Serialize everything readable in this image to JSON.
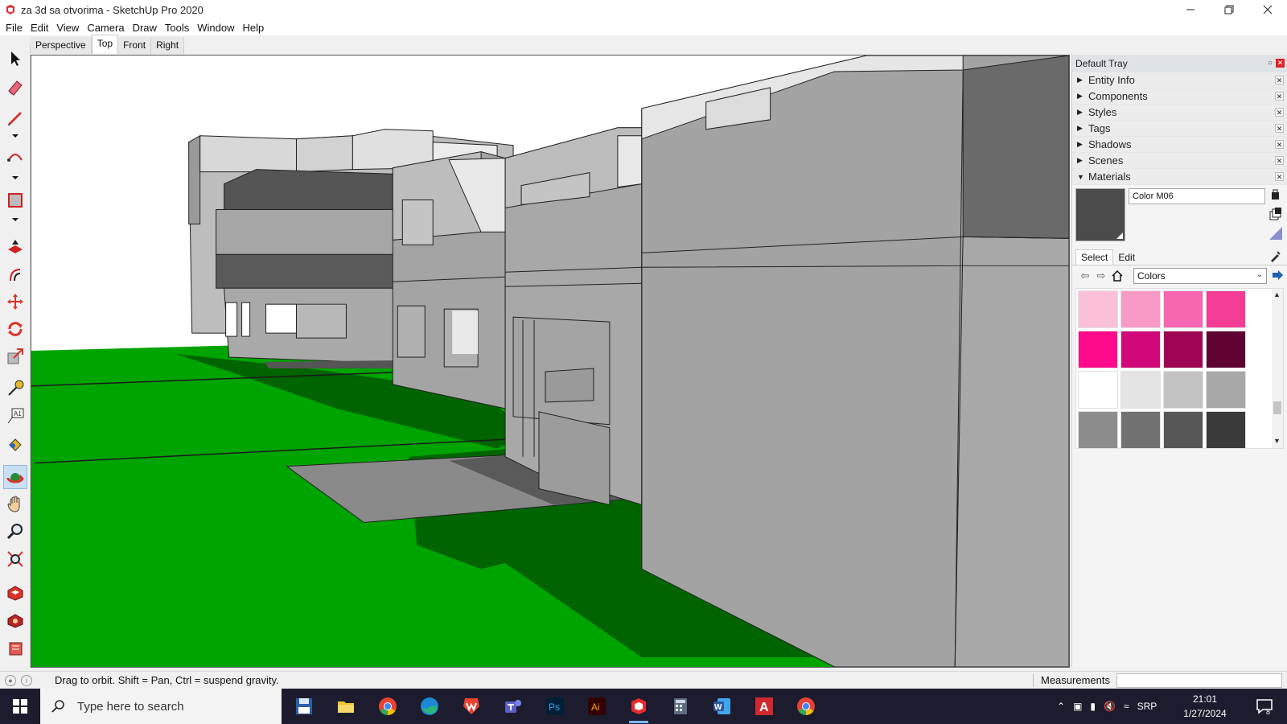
{
  "window": {
    "title": "za 3d sa otvorima - SketchUp Pro 2020"
  },
  "menu": [
    "File",
    "Edit",
    "View",
    "Camera",
    "Draw",
    "Tools",
    "Window",
    "Help"
  ],
  "scene_tabs": [
    "Perspective",
    "Top",
    "Front",
    "Right"
  ],
  "active_scene_tab": "Top",
  "tools": [
    {
      "name": "select",
      "icon": "select-arrow-icon"
    },
    {
      "name": "eraser",
      "icon": "eraser-icon"
    },
    {
      "name": "line",
      "icon": "pencil-line-icon"
    },
    {
      "name": "arc",
      "icon": "arc-icon"
    },
    {
      "name": "rectangle",
      "icon": "rectangle-icon"
    },
    {
      "name": "push-pull",
      "icon": "push-pull-icon"
    },
    {
      "name": "offset",
      "icon": "offset-icon"
    },
    {
      "name": "move",
      "icon": "move-icon"
    },
    {
      "name": "rotate",
      "icon": "rotate-icon"
    },
    {
      "name": "scale",
      "icon": "scale-icon"
    },
    {
      "name": "tape-measure",
      "icon": "tape-measure-icon"
    },
    {
      "name": "text",
      "icon": "text-icon"
    },
    {
      "name": "paint-bucket",
      "icon": "paint-bucket-icon"
    },
    {
      "name": "orbit",
      "icon": "orbit-icon"
    },
    {
      "name": "pan",
      "icon": "pan-hand-icon"
    },
    {
      "name": "zoom",
      "icon": "zoom-icon"
    },
    {
      "name": "zoom-extents",
      "icon": "zoom-extents-icon"
    },
    {
      "name": "warehouse",
      "icon": "3d-warehouse-icon"
    },
    {
      "name": "extension-warehouse",
      "icon": "extension-warehouse-icon"
    },
    {
      "name": "layout",
      "icon": "layout-icon"
    }
  ],
  "active_tool": "orbit",
  "tray": {
    "title": "Default Tray",
    "panels": [
      "Entity Info",
      "Components",
      "Styles",
      "Tags",
      "Shadows",
      "Scenes",
      "Materials"
    ],
    "expanded_panel": "Materials"
  },
  "materials": {
    "current_name": "Color M06",
    "current_color": "#4b4b4b",
    "tabs": [
      "Select",
      "Edit"
    ],
    "active_tab": "Select",
    "library": "Colors",
    "swatches": [
      [
        "#f9c0d8",
        "#f79ac6",
        "#f766b0",
        "#f33c95"
      ],
      [
        "#ff0a8a",
        "#d1077a",
        "#9e0554",
        "#5e0332"
      ],
      [
        "#ffffff",
        "#e4e4e4",
        "#c3c3c3",
        "#a8a8a8"
      ],
      [
        "#8d8d8d",
        "#717171",
        "#575757",
        "#3a3a3a"
      ]
    ]
  },
  "status": {
    "hint": "Drag to orbit. Shift = Pan, Ctrl = suspend gravity.",
    "measurements_label": "Measurements"
  },
  "taskbar": {
    "search_placeholder": "Type here to search",
    "apps": [
      {
        "name": "save",
        "icon": "floppy-icon",
        "color": "#2b5fad"
      },
      {
        "name": "file-explorer",
        "icon": "folder-icon",
        "color": "#f2c232"
      },
      {
        "name": "chrome",
        "icon": "chrome-icon",
        "color": "#e94235"
      },
      {
        "name": "edge",
        "icon": "edge-icon",
        "color": "#2fb47b"
      },
      {
        "name": "wps",
        "icon": "wps-icon",
        "color": "#e8432e"
      },
      {
        "name": "teams",
        "icon": "teams-icon",
        "color": "#5b5fc7"
      },
      {
        "name": "photoshop",
        "icon": "photoshop-icon",
        "color": "#001e36",
        "label": "Ps"
      },
      {
        "name": "illustrator",
        "icon": "illustrator-icon",
        "color": "#330000",
        "label": "Ai"
      },
      {
        "name": "sketchup",
        "icon": "sketchup-icon",
        "color": "#e72b2d"
      },
      {
        "name": "calculator",
        "icon": "calculator-icon",
        "color": "#5b6b82"
      },
      {
        "name": "word",
        "icon": "word-icon",
        "color": "#2b579a",
        "label": "W"
      },
      {
        "name": "autocad",
        "icon": "autocad-icon",
        "color": "#d0282d",
        "label": "A"
      },
      {
        "name": "chrome-2",
        "icon": "chrome-icon",
        "color": "#e94235"
      }
    ],
    "active_app": "sketchup",
    "language": "SRP",
    "time": "21:01",
    "date": "1/27/2024",
    "notifications": "8"
  }
}
